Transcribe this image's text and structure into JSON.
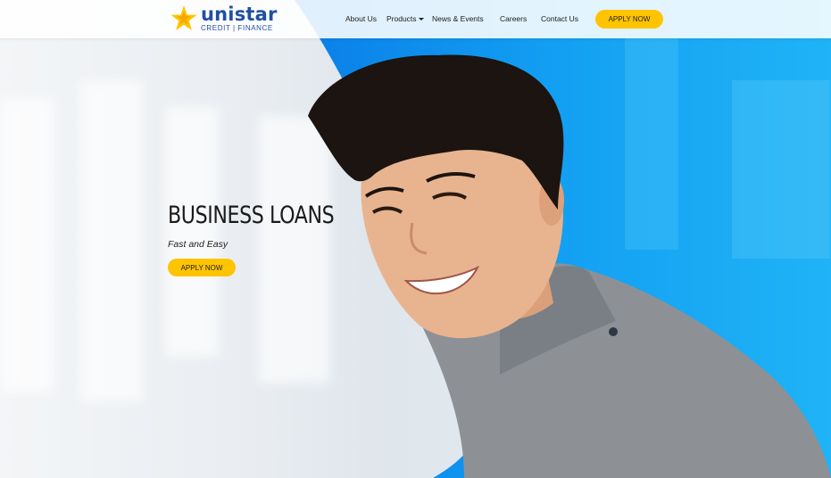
{
  "brand": {
    "name": "unistar",
    "tagline": "CREDIT | FINANCE",
    "logo_icon": "star-logo-icon"
  },
  "nav": {
    "items": [
      {
        "label": "About Us"
      },
      {
        "label": "Products",
        "has_dropdown": true
      },
      {
        "label": "News & Events"
      },
      {
        "label": "Careers"
      },
      {
        "label": "Contact Us"
      }
    ],
    "apply_label": "APPLY NOW"
  },
  "hero": {
    "title": "BUSINESS LOANS",
    "subtitle": "Fast and Easy",
    "apply_label": "APPLY NOW"
  },
  "colors": {
    "accent": "#ffc400",
    "brand_blue": "#1f4fa3",
    "hero_blue": "#1aa3f0"
  }
}
